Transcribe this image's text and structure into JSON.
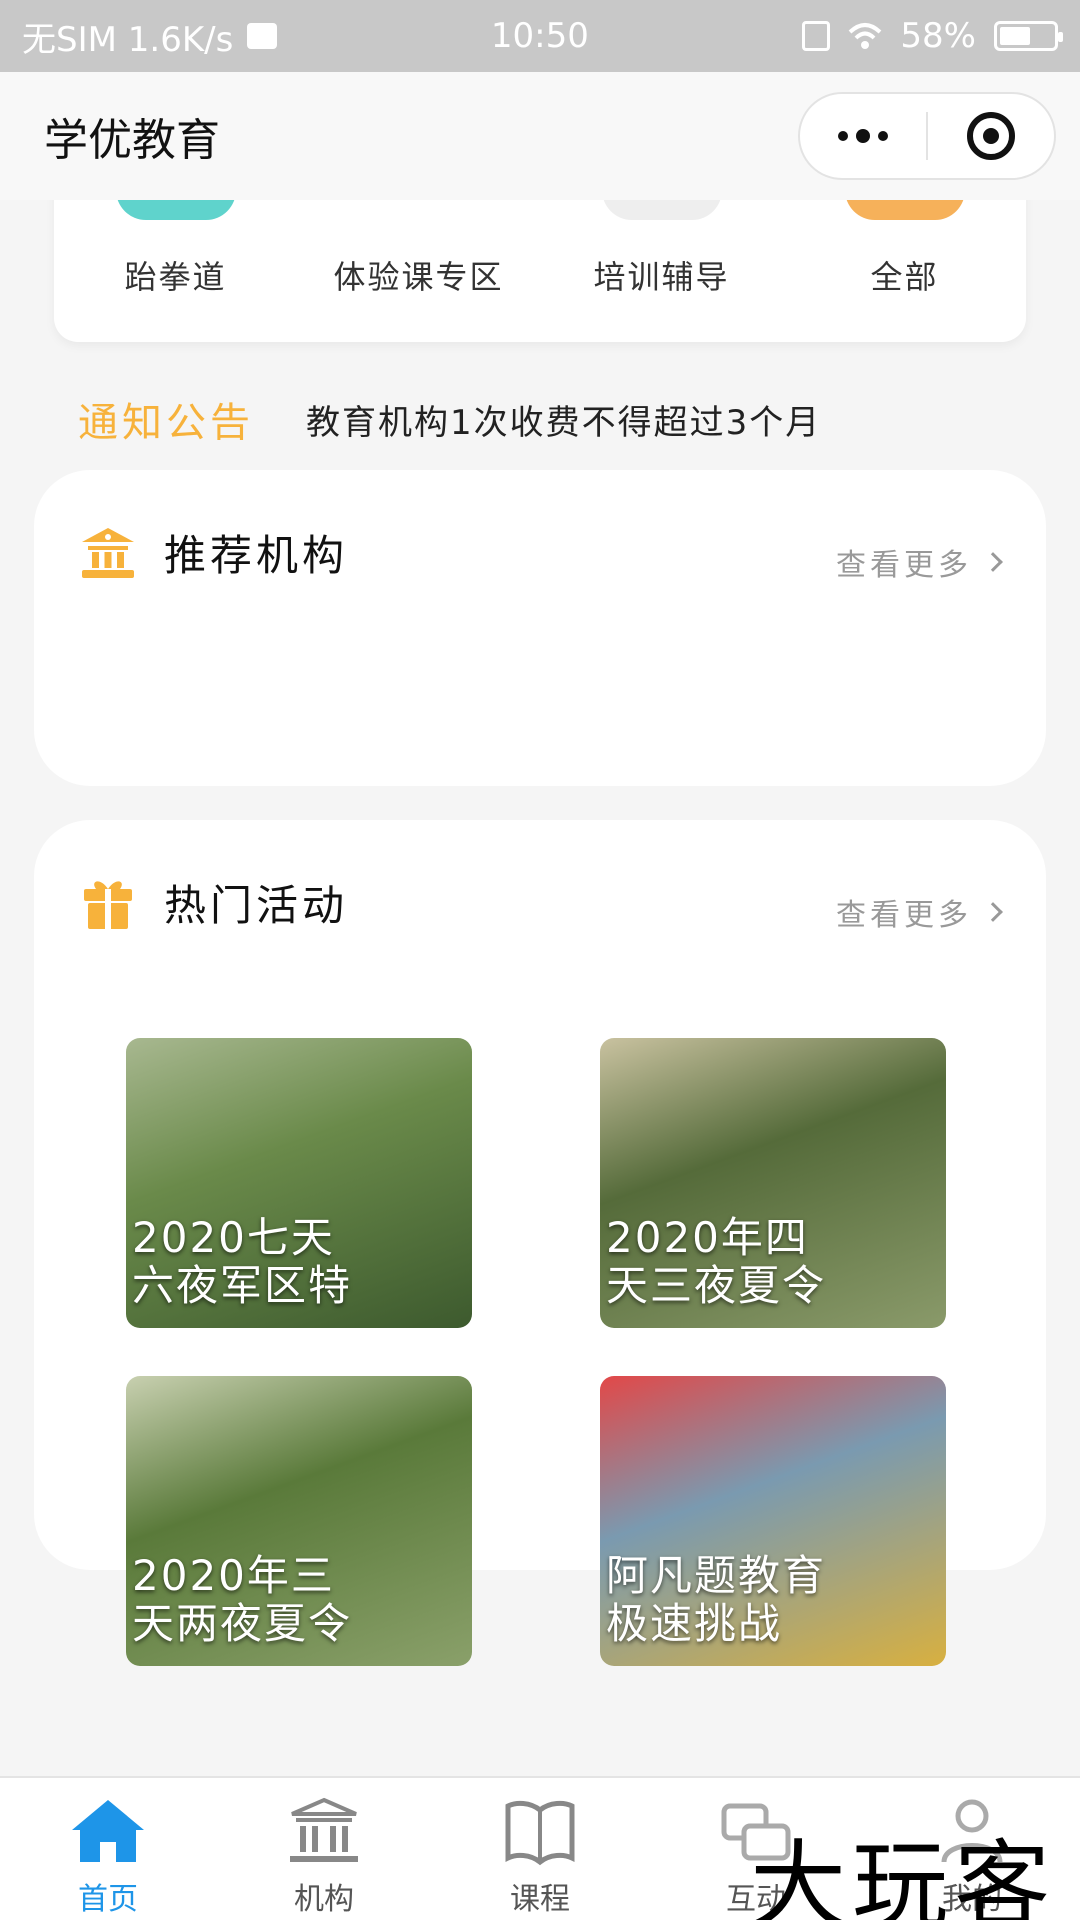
{
  "status_bar": {
    "carrier": "无SIM 1.6K/s",
    "time": "10:50",
    "battery_text": "58%",
    "battery_level": 0.58
  },
  "nav": {
    "title": "学优教育"
  },
  "categories": [
    {
      "label": "跆拳道",
      "color": "#5fd3cc"
    },
    {
      "label": "体验课专区",
      "color": "#ffffff"
    },
    {
      "label": "培训辅导",
      "color": "#eeeeee"
    },
    {
      "label": "全部",
      "color": "#f6b15a"
    }
  ],
  "notice": {
    "tag": "通知公告",
    "text": "教育机构1次收费不得超过3个月"
  },
  "recommend": {
    "title": "推荐机构",
    "more": "查看更多",
    "icon": "bank-icon"
  },
  "hot": {
    "title": "热门活动",
    "more": "查看更多",
    "icon": "gift-icon",
    "items": [
      {
        "caption": "2020七天\n六夜军区特",
        "colors": [
          "#6a8a4a",
          "#3d5a2e",
          "#a8b890"
        ]
      },
      {
        "caption": "2020年四\n天三夜夏令",
        "colors": [
          "#556b3a",
          "#8a9a6a",
          "#c9c2a0"
        ]
      },
      {
        "caption": "2020年三\n天两夜夏令",
        "colors": [
          "#5a7a3a",
          "#8aa06a",
          "#c8d0b0"
        ]
      },
      {
        "caption": "阿凡题教育\n 极速挑战",
        "colors": [
          "#7a9ab0",
          "#d8b040",
          "#e24848"
        ]
      }
    ]
  },
  "tabs": [
    {
      "label": "首页",
      "icon": "home-icon",
      "active": true
    },
    {
      "label": "机构",
      "icon": "institution-icon",
      "active": false
    },
    {
      "label": "课程",
      "icon": "book-icon",
      "active": false
    },
    {
      "label": "互动",
      "icon": "chat-icon",
      "active": false
    },
    {
      "label": "我的",
      "icon": "user-icon",
      "active": false
    }
  ],
  "watermark": "大玩客",
  "colors": {
    "accent": "#f7b23b",
    "tab_active": "#1e95e8"
  }
}
